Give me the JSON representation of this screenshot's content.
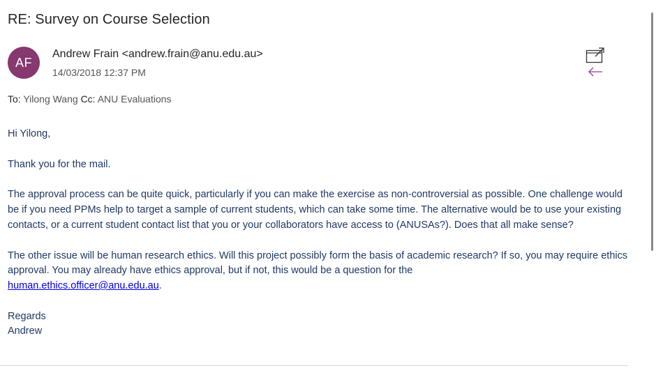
{
  "email": {
    "subject": "RE: Survey on Course Selection",
    "avatar_initials": "AF",
    "sender": "Andrew Frain <andrew.frain@anu.edu.au>",
    "date": "14/03/2018 12:37 PM",
    "to_label": "To:",
    "to": "Yilong Wang",
    "cc_label": "Cc:",
    "cc": "ANU Evaluations",
    "greeting": "Hi Yilong,",
    "para1": "Thank you for the mail.",
    "para2": "The approval process can be quite quick, particularly if you can make the exercise as non-controversial as possible. One challenge would be if you need PPMs help to target a sample of current students, which can take some time. The alternative would be to use your existing contacts, or a current student contact list that you or your collaborators have access to (ANUSAs?). Does that all make sense?",
    "para3_text": "The other issue will be human research ethics. Will this project possibly form the basis of academic research? If so, you may require ethics approval. You may already have ethics approval, but if not, this would be a question for the",
    "para3_link": "human.ethics.officer@anu.edu.au",
    "para3_end": ".",
    "signoff": "Regards",
    "signature": "Andrew"
  },
  "icons": {
    "popout": "popout-icon",
    "reply": "reply-arrow-icon"
  },
  "colors": {
    "avatar_bg": "#86386f",
    "body_text": "#1f3864",
    "reply_icon": "#9b3b8f",
    "link": "#0000ee"
  }
}
